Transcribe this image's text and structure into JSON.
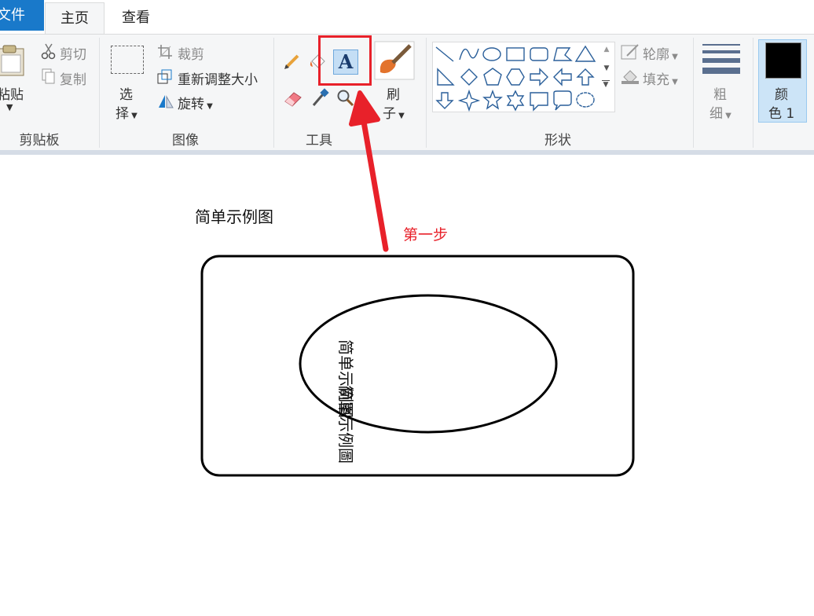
{
  "tabs": {
    "file": "文件",
    "home": "主页",
    "view": "查看"
  },
  "clipboard": {
    "paste": "粘贴",
    "cut": "剪切",
    "copy": "复制",
    "group": "剪贴板"
  },
  "image": {
    "select_line1": "选",
    "select_line2": "择",
    "crop": "裁剪",
    "resize": "重新调整大小",
    "rotate": "旋转",
    "group": "图像"
  },
  "tools": {
    "group": "工具",
    "text_glyph": "A"
  },
  "brushes": {
    "line1": "刷",
    "line2": "子"
  },
  "shapes": {
    "outline": "轮廓",
    "fill": "填充",
    "group": "形状"
  },
  "size": {
    "line1": "粗",
    "line2": "细"
  },
  "color1": {
    "line1": "颜",
    "line2": "色 1",
    "value": "#000000"
  },
  "canvas": {
    "title": "简单示例图",
    "annotation": "第一步",
    "vertical_text_1": "简单示例图",
    "vertical_text_2": "简單示例圖"
  },
  "colors": {
    "accent": "#1979ca",
    "highlight": "#e8212a"
  }
}
